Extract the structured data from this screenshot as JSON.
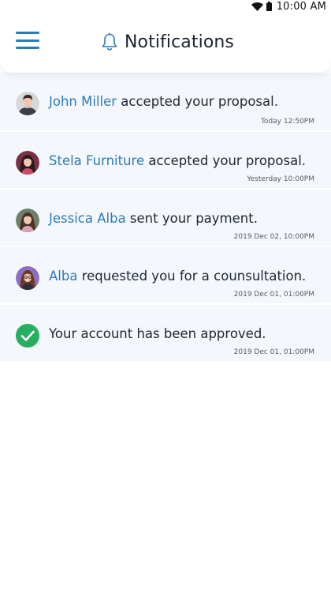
{
  "status_bar": {
    "time": "10:00 AM"
  },
  "header": {
    "title": "Notifications"
  },
  "notifications": [
    {
      "name": "John Miller",
      "text": " accepted your proposal.",
      "time": "Today 12:50PM",
      "avatar": "avatar-man"
    },
    {
      "name": "Stela Furniture",
      "text": " accepted your proposal.",
      "time": "Yesterday 10:00PM",
      "avatar": "avatar-woman"
    },
    {
      "name": "Jessica Alba",
      "text": " sent your payment.",
      "time": "2019 Dec 02, 10:00PM",
      "avatar": "avatar-woman"
    },
    {
      "name": "Alba",
      "text": " requested you for a counsultation.",
      "time": "2019 Dec 01, 01:00PM",
      "avatar": "avatar-woman"
    },
    {
      "name": "",
      "text": "Your account has been approved.",
      "time": "2019 Dec 01, 01:00PM",
      "avatar": "check-icon"
    }
  ],
  "colors": {
    "accent": "#2e7ab8",
    "row_bg": "#f4f8fd",
    "success": "#27ae60"
  }
}
